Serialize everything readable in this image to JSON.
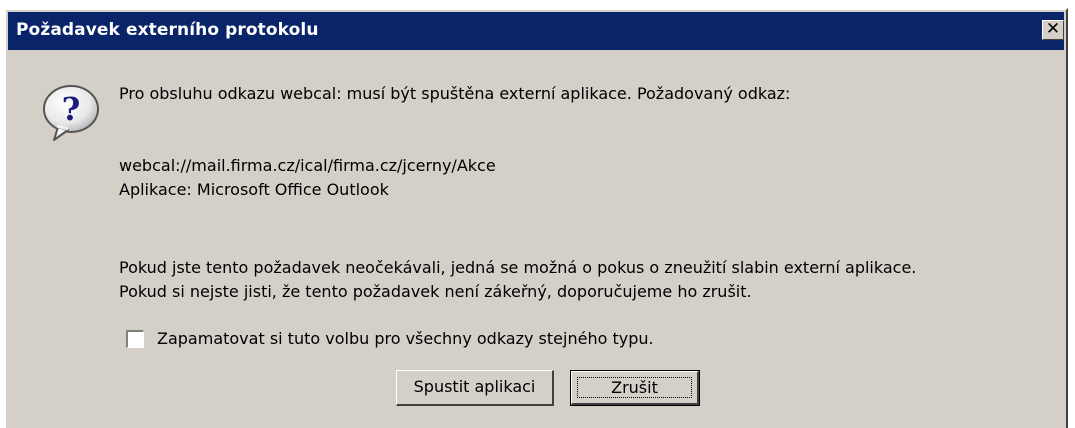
{
  "dialog": {
    "title": "Požadavek externího protokolu",
    "close_glyph": "✕",
    "icon": "question-bubble-icon",
    "message": "Pro obsluhu odkazu webcal: musí být spuštěna externí aplikace. Požadovaný odkaz:",
    "link": "webcal://mail.firma.cz/ical/firma.cz/jcerny/Akce",
    "application": "Aplikace: Microsoft Office Outlook",
    "warning_line1": "Pokud jste tento požadavek neočekávali, jedná se možná o pokus o zneužití slabin externí aplikace.",
    "warning_line2": "Pokud si nejste jisti, že tento požadavek není zákeřný, doporučujeme ho zrušit.",
    "remember_label": "Zapamatovat si tuto volbu pro všechny odkazy stejného typu.",
    "remember_checked": false,
    "run_button": "Spustit aplikaci",
    "cancel_button": "Zrušit"
  },
  "colors": {
    "titlebar": "#0a246a",
    "face": "#d4d0c8"
  }
}
